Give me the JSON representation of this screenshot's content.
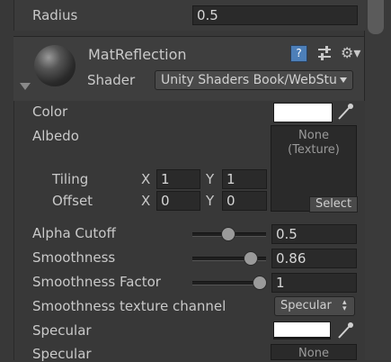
{
  "top_row": {
    "label": "Radius",
    "value": "0.5"
  },
  "material": {
    "name": "MatReflection",
    "shader_label": "Shader",
    "shader_value": "Unity Shaders Book/WebStu"
  },
  "icons": {
    "help": "help-book-icon",
    "preset": "preset-sliders-icon",
    "settings": "gear-icon",
    "collapse": "triangle-down-icon",
    "eyedropper": "eyedropper-icon"
  },
  "properties": {
    "color_label": "Color",
    "albedo_label": "Albedo",
    "albedo_texture": "None\n(Texture)",
    "albedo_select": "Select",
    "tiling_label": "Tiling",
    "tiling_x_label": "X",
    "tiling_x": "1",
    "tiling_y_label": "Y",
    "tiling_y": "1",
    "offset_label": "Offset",
    "offset_x_label": "X",
    "offset_x": "0",
    "offset_y_label": "Y",
    "offset_y": "0",
    "alpha_cutoff_label": "Alpha Cutoff",
    "alpha_cutoff": "0.5",
    "smoothness_label": "Smoothness",
    "smoothness": "0.86",
    "smoothness_factor_label": "Smoothness Factor",
    "smoothness_factor": "1",
    "smoothness_channel_label": "Smoothness texture channel",
    "smoothness_channel": "Specular",
    "specular_label": "Specular",
    "specular2_label": "Specular",
    "specular2_texture": "None"
  },
  "colors": {
    "background": "#383838",
    "field": "#2a2a2a",
    "swatch": "#ffffff"
  }
}
